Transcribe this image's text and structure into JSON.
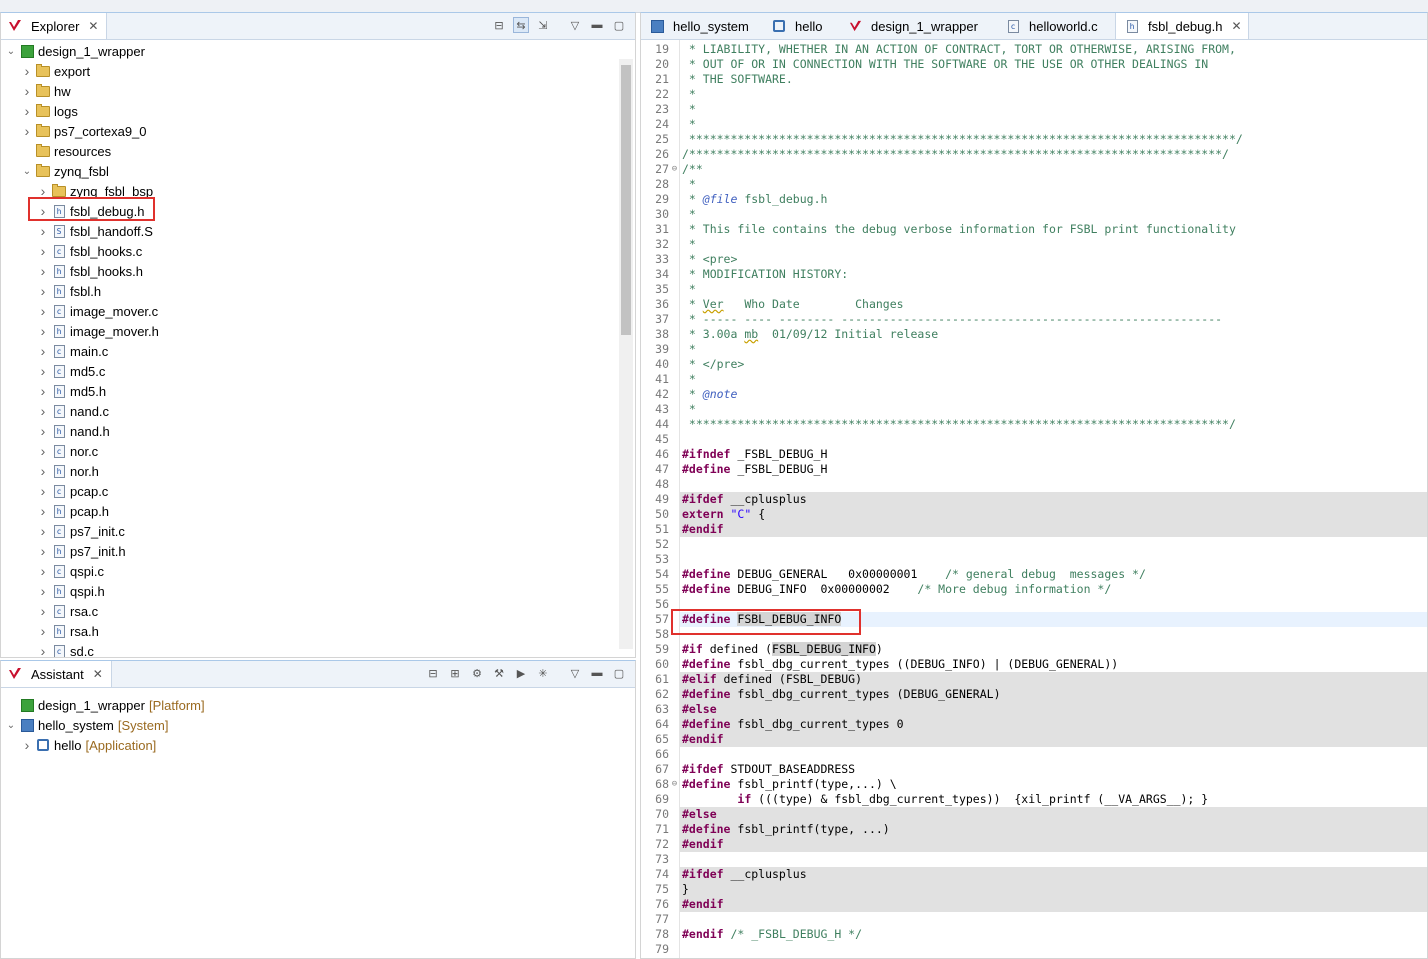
{
  "explorer": {
    "title": "Explorer",
    "toolbar_icons": [
      "collapse-all-icon",
      "link-with-editor-icon",
      "import-icon",
      "view-menu-icon",
      "minimize-icon",
      "maximize-icon"
    ],
    "tree": [
      {
        "label": "design_1_wrapper",
        "icon": "project-icon",
        "expanded": true,
        "depth": 0
      },
      {
        "label": "export",
        "icon": "folder-icon",
        "expanded": false,
        "depth": 1
      },
      {
        "label": "hw",
        "icon": "folder-icon",
        "expanded": false,
        "depth": 1
      },
      {
        "label": "logs",
        "icon": "folder-icon",
        "expanded": false,
        "depth": 1
      },
      {
        "label": "ps7_cortexa9_0",
        "icon": "folder-icon",
        "expanded": false,
        "depth": 1
      },
      {
        "label": "resources",
        "icon": "folder-icon",
        "expanded": null,
        "depth": 1
      },
      {
        "label": "zynq_fsbl",
        "icon": "folder-icon",
        "expanded": true,
        "depth": 1
      },
      {
        "label": "zynq_fsbl_bsp",
        "icon": "folder-icon",
        "expanded": false,
        "depth": 2
      },
      {
        "label": "fsbl_debug.h",
        "icon": "h-file-icon",
        "expanded": false,
        "depth": 2,
        "highlighted": true
      },
      {
        "label": "fsbl_handoff.S",
        "icon": "s-file-icon",
        "expanded": false,
        "depth": 2
      },
      {
        "label": "fsbl_hooks.c",
        "icon": "c-file-icon",
        "expanded": false,
        "depth": 2
      },
      {
        "label": "fsbl_hooks.h",
        "icon": "h-file-icon",
        "expanded": false,
        "depth": 2
      },
      {
        "label": "fsbl.h",
        "icon": "h-file-icon",
        "expanded": false,
        "depth": 2
      },
      {
        "label": "image_mover.c",
        "icon": "c-file-icon",
        "expanded": false,
        "depth": 2
      },
      {
        "label": "image_mover.h",
        "icon": "h-file-icon",
        "expanded": false,
        "depth": 2
      },
      {
        "label": "main.c",
        "icon": "c-file-icon",
        "expanded": false,
        "depth": 2
      },
      {
        "label": "md5.c",
        "icon": "c-file-icon",
        "expanded": false,
        "depth": 2
      },
      {
        "label": "md5.h",
        "icon": "h-file-icon",
        "expanded": false,
        "depth": 2
      },
      {
        "label": "nand.c",
        "icon": "c-file-icon",
        "expanded": false,
        "depth": 2
      },
      {
        "label": "nand.h",
        "icon": "h-file-icon",
        "expanded": false,
        "depth": 2
      },
      {
        "label": "nor.c",
        "icon": "c-file-icon",
        "expanded": false,
        "depth": 2
      },
      {
        "label": "nor.h",
        "icon": "h-file-icon",
        "expanded": false,
        "depth": 2
      },
      {
        "label": "pcap.c",
        "icon": "c-file-icon",
        "expanded": false,
        "depth": 2
      },
      {
        "label": "pcap.h",
        "icon": "h-file-icon",
        "expanded": false,
        "depth": 2
      },
      {
        "label": "ps7_init.c",
        "icon": "c-file-icon",
        "expanded": false,
        "depth": 2
      },
      {
        "label": "ps7_init.h",
        "icon": "h-file-icon",
        "expanded": false,
        "depth": 2
      },
      {
        "label": "qspi.c",
        "icon": "c-file-icon",
        "expanded": false,
        "depth": 2
      },
      {
        "label": "qspi.h",
        "icon": "h-file-icon",
        "expanded": false,
        "depth": 2
      },
      {
        "label": "rsa.c",
        "icon": "c-file-icon",
        "expanded": false,
        "depth": 2
      },
      {
        "label": "rsa.h",
        "icon": "h-file-icon",
        "expanded": false,
        "depth": 2
      },
      {
        "label": "sd.c",
        "icon": "c-file-icon",
        "expanded": false,
        "depth": 2
      }
    ]
  },
  "assistant": {
    "title": "Assistant",
    "toolbar_icons": [
      "collapse-all-icon",
      "expand-all-icon",
      "settings-icon",
      "build-icon",
      "run-icon",
      "debug-icon",
      "view-menu-icon",
      "minimize-icon",
      "maximize-icon"
    ],
    "tree": [
      {
        "label": "design_1_wrapper",
        "tag": "[Platform]",
        "icon": "platform-icon",
        "expanded": null,
        "depth": 0
      },
      {
        "label": "hello_system",
        "tag": "[System]",
        "icon": "system-icon",
        "expanded": true,
        "depth": 0
      },
      {
        "label": "hello",
        "tag": "[Application]",
        "icon": "application-icon",
        "expanded": false,
        "depth": 1
      }
    ]
  },
  "editor": {
    "tabs": [
      {
        "label": "hello_system",
        "icon": "system-icon",
        "active": false
      },
      {
        "label": "hello",
        "icon": "application-icon",
        "active": false
      },
      {
        "label": "design_1_wrapper",
        "icon": "vitis-icon",
        "active": false
      },
      {
        "label": "helloworld.c",
        "icon": "c-file-icon",
        "active": false
      },
      {
        "label": "fsbl_debug.h",
        "icon": "h-file-icon",
        "active": true
      }
    ],
    "close_glyph": "✕",
    "lines": [
      {
        "n": "19",
        "text": " * LIABILITY, WHETHER IN AN ACTION OF CONTRACT, TORT OR OTHERWISE, ARISING FROM,"
      },
      {
        "n": "20",
        "text": " * OUT OF OR IN CONNECTION WITH THE SOFTWARE OR THE USE OR OTHER DEALINGS IN"
      },
      {
        "n": "21",
        "text": " * THE SOFTWARE."
      },
      {
        "n": "22",
        "text": " *"
      },
      {
        "n": "23",
        "text": " *"
      },
      {
        "n": "24",
        "text": " *"
      },
      {
        "n": "25",
        "text": " *******************************************************************************/"
      },
      {
        "n": "26",
        "text": "/*****************************************************************************/"
      },
      {
        "n": "27",
        "text": "/**",
        "fold": true
      },
      {
        "n": "28",
        "text": " *"
      },
      {
        "n": "29",
        "text": " * @file fsbl_debug.h"
      },
      {
        "n": "30",
        "text": " *"
      },
      {
        "n": "31",
        "text": " * This file contains the debug verbose information for FSBL print functionality"
      },
      {
        "n": "32",
        "text": " *"
      },
      {
        "n": "33",
        "text": " * <pre>"
      },
      {
        "n": "34",
        "text": " * MODIFICATION HISTORY:"
      },
      {
        "n": "35",
        "text": " *"
      },
      {
        "n": "36",
        "text": " * Ver   Who Date        Changes"
      },
      {
        "n": "37",
        "text": " * ----- ---- -------- -------------------------------------------------------"
      },
      {
        "n": "38",
        "text": " * 3.00a mb  01/09/12 Initial release"
      },
      {
        "n": "39",
        "text": " *"
      },
      {
        "n": "40",
        "text": " * </pre>"
      },
      {
        "n": "41",
        "text": " *"
      },
      {
        "n": "42",
        "text": " * @note"
      },
      {
        "n": "43",
        "text": " *"
      },
      {
        "n": "44",
        "text": " ******************************************************************************/"
      },
      {
        "n": "45",
        "text": ""
      },
      {
        "n": "46",
        "text": "#ifndef _FSBL_DEBUG_H"
      },
      {
        "n": "47",
        "text": "#define _FSBL_DEBUG_H"
      },
      {
        "n": "48",
        "text": ""
      },
      {
        "n": "49",
        "text": "#ifdef __cplusplus",
        "inactive": true
      },
      {
        "n": "50",
        "text": "extern \"C\" {",
        "inactive": true
      },
      {
        "n": "51",
        "text": "#endif",
        "inactive": true
      },
      {
        "n": "52",
        "text": ""
      },
      {
        "n": "53",
        "text": ""
      },
      {
        "n": "54",
        "text": "#define DEBUG_GENERAL   0x00000001    /* general debug  messages */"
      },
      {
        "n": "55",
        "text": "#define DEBUG_INFO  0x00000002    /* More debug information */"
      },
      {
        "n": "56",
        "text": ""
      },
      {
        "n": "57",
        "text": "#define FSBL_DEBUG_INFO",
        "current": true,
        "highlighted": true
      },
      {
        "n": "58",
        "text": ""
      },
      {
        "n": "59",
        "text": "#if defined (FSBL_DEBUG_INFO)"
      },
      {
        "n": "60",
        "text": "#define fsbl_dbg_current_types ((DEBUG_INFO) | (DEBUG_GENERAL))"
      },
      {
        "n": "61",
        "text": "#elif defined (FSBL_DEBUG)",
        "inactive": true
      },
      {
        "n": "62",
        "text": "#define fsbl_dbg_current_types (DEBUG_GENERAL)",
        "inactive": true
      },
      {
        "n": "63",
        "text": "#else",
        "inactive": true
      },
      {
        "n": "64",
        "text": "#define fsbl_dbg_current_types 0",
        "inactive": true
      },
      {
        "n": "65",
        "text": "#endif",
        "inactive": true
      },
      {
        "n": "66",
        "text": ""
      },
      {
        "n": "67",
        "text": "#ifdef STDOUT_BASEADDRESS"
      },
      {
        "n": "68",
        "text": "#define fsbl_printf(type,...) \\",
        "fold": true
      },
      {
        "n": "69",
        "text": "        if (((type) & fsbl_dbg_current_types))  {xil_printf (__VA_ARGS__); }"
      },
      {
        "n": "70",
        "text": "#else",
        "inactive": true
      },
      {
        "n": "71",
        "text": "#define fsbl_printf(type, ...)",
        "inactive": true
      },
      {
        "n": "72",
        "text": "#endif",
        "inactive": true
      },
      {
        "n": "73",
        "text": ""
      },
      {
        "n": "74",
        "text": "#ifdef __cplusplus",
        "inactive": true
      },
      {
        "n": "75",
        "text": "}",
        "inactive": true
      },
      {
        "n": "76",
        "text": "#endif",
        "inactive": true
      },
      {
        "n": "77",
        "text": ""
      },
      {
        "n": "78",
        "text": "#endif /* _FSBL_DEBUG_H */"
      },
      {
        "n": "79",
        "text": ""
      }
    ]
  },
  "colors": {
    "highlight_box": "#e0312d",
    "comment": "#3f7f5f",
    "keyword": "#7f0055",
    "string": "#2a00ff",
    "inactive_bg": "#e1e1e1",
    "tag": "#9a6a20"
  }
}
